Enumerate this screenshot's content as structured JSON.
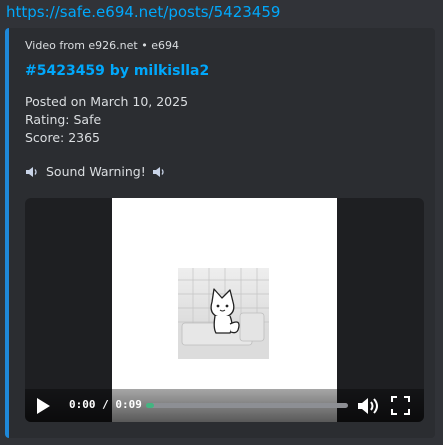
{
  "message": {
    "link_text": "https://safe.e694.net/posts/5423459"
  },
  "embed": {
    "provider": "Video from e926.net • e694",
    "title": "#5423459 by milkislla2",
    "posted": "Posted on March 10, 2025",
    "rating": "Rating: Safe",
    "score": "Score: 2365",
    "sound_warning": "Sound Warning!",
    "accent_color": "#1e88d9"
  },
  "video": {
    "current_time": "0:00",
    "separator": "/",
    "duration": "0:09",
    "progress_fraction": 0.04,
    "progress_color": "#43b581",
    "icons": [
      "play-icon",
      "volume-icon",
      "fullscreen-icon"
    ]
  }
}
